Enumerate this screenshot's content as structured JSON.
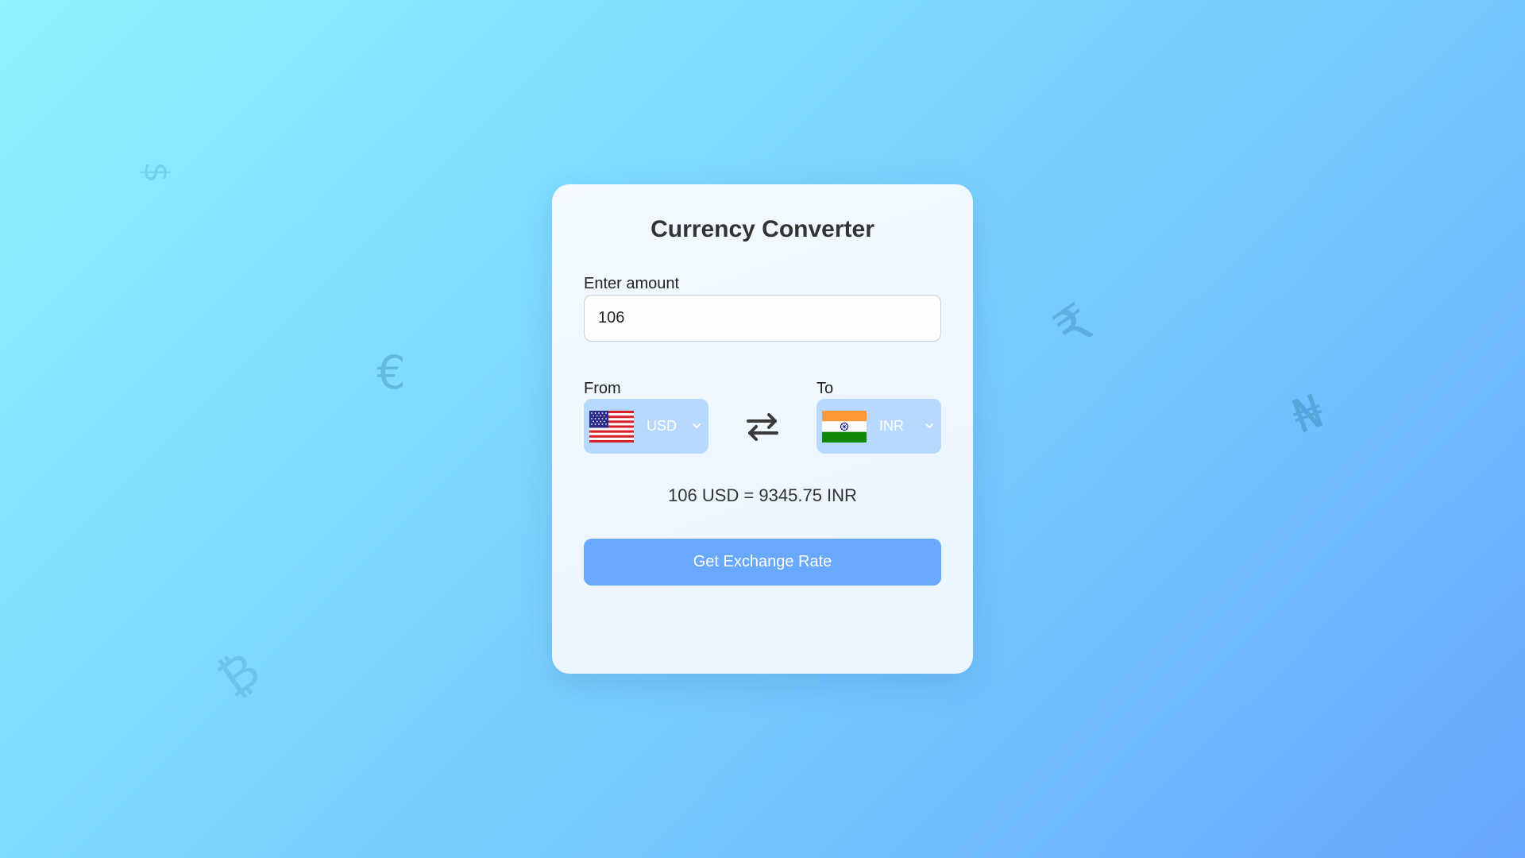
{
  "background": {
    "symbols": [
      "$",
      "€",
      "₹",
      "₦",
      "₿"
    ]
  },
  "converter": {
    "title": "Currency Converter",
    "amount_label": "Enter amount",
    "amount_value": "106",
    "from_label": "From",
    "from_code": "USD",
    "to_label": "To",
    "to_code": "INR",
    "result_text": "106 USD = 9345.75 INR",
    "button_label": "Get Exchange Rate"
  },
  "icons": {
    "from_flag": "us-flag-icon",
    "to_flag": "india-flag-icon",
    "swap": "swap-arrows-icon",
    "dropdown": "chevron-down-icon"
  },
  "colors": {
    "button": "#69a8ff",
    "select_bg": "#b7d8ff",
    "card_bg": "#eef7ff",
    "text": "#333333"
  }
}
